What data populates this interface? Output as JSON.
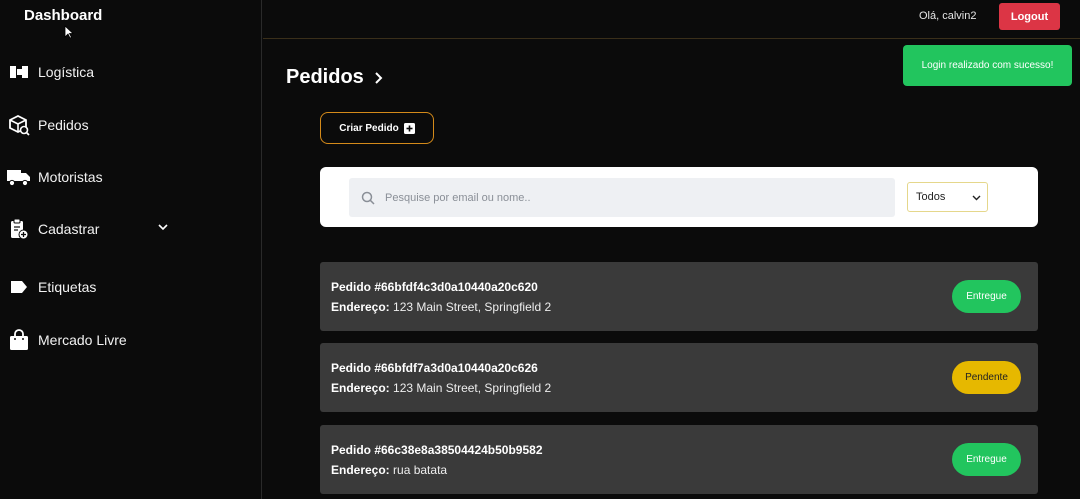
{
  "sidebar": {
    "brand": "Dashboard",
    "items": [
      {
        "label": "Logística",
        "icon": "warehouse-icon"
      },
      {
        "label": "Pedidos",
        "icon": "package-search-icon"
      },
      {
        "label": "Motoristas",
        "icon": "truck-icon"
      },
      {
        "label": "Cadastrar",
        "icon": "clipboard-add-icon"
      },
      {
        "label": "Etiquetas",
        "icon": "tag-icon"
      },
      {
        "label": "Mercado Livre",
        "icon": "shopping-bag-icon"
      }
    ]
  },
  "header": {
    "greeting": "Olá, calvin2",
    "logout_label": "Logout"
  },
  "toast": {
    "message": "Login realizado com sucesso!"
  },
  "main": {
    "title": "Pedidos",
    "create_label": "Criar Pedido",
    "search_placeholder": "Pesquise por email ou nome..",
    "filter_value": "Todos",
    "address_label": "Endereço:",
    "orders": [
      {
        "id": "Pedido #66bfdf4c3d0a10440a20c620",
        "address": "123 Main Street, Springfield 2",
        "status": "Entregue"
      },
      {
        "id": "Pedido #66bfdf7a3d0a10440a20c626",
        "address": "123 Main Street, Springfield 2",
        "status": "Pendente"
      },
      {
        "id": "Pedido #66c38e8a38504424b50b9582",
        "address": "rua batata",
        "status": "Entregue"
      }
    ]
  },
  "colors": {
    "background": "#0b0b0b",
    "card": "#3a3a3a",
    "success": "#22c55e",
    "warning": "#e6b800",
    "danger": "#dc3545",
    "accent_border": "#d48a1a"
  }
}
